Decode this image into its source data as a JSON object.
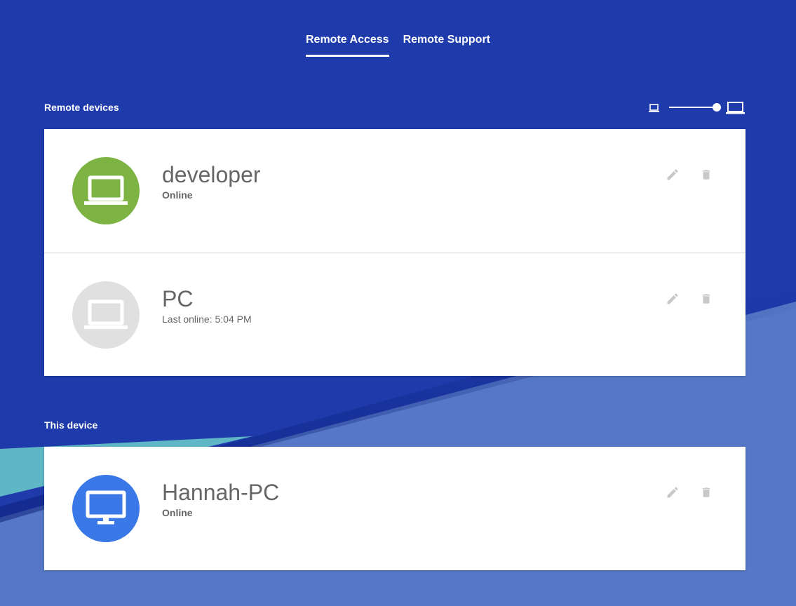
{
  "tabs": [
    {
      "label": "Remote Access",
      "active": true
    },
    {
      "label": "Remote Support",
      "active": false
    }
  ],
  "remote_section": {
    "label": "Remote devices",
    "size_slider": {
      "value": 1.0,
      "min_icon": "small-laptop-icon",
      "max_icon": "large-laptop-icon"
    },
    "devices": [
      {
        "name": "developer",
        "status": "Online",
        "status_bold": true,
        "icon": "laptop-icon",
        "avatar_color": "#7cb342"
      },
      {
        "name": "PC",
        "status": "Last online: 5:04 PM",
        "status_bold": false,
        "icon": "laptop-icon",
        "avatar_color": "#e0e0e0"
      }
    ]
  },
  "this_section": {
    "label": "This device",
    "devices": [
      {
        "name": "Hannah-PC",
        "status": "Online",
        "status_bold": true,
        "icon": "monitor-icon",
        "avatar_color": "#3b78e7"
      }
    ]
  },
  "colors": {
    "background_dark": "#1e3aab",
    "background_light": "#5677c6",
    "accent_teal": "#5fb6c4",
    "action_icon": "#c8c8c8"
  }
}
